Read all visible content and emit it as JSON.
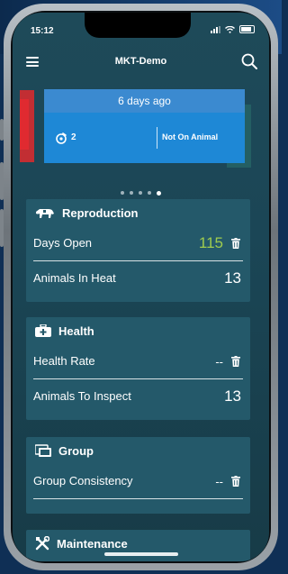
{
  "status": {
    "time": "15:12"
  },
  "header": {
    "title": "MKT-Demo"
  },
  "banner": {
    "heading": "6 days ago",
    "count": "2",
    "status": "Not On Animal"
  },
  "carousel": {
    "dots": 5,
    "active": 4
  },
  "sections": {
    "reproduction": {
      "title": "Reproduction",
      "rows": [
        {
          "label": "Days Open",
          "value": "115"
        },
        {
          "label": "Animals In Heat",
          "value": "13"
        }
      ]
    },
    "health": {
      "title": "Health",
      "rows": [
        {
          "label": "Health Rate",
          "value": "--"
        },
        {
          "label": "Animals To Inspect",
          "value": "13"
        }
      ]
    },
    "group": {
      "title": "Group",
      "rows": [
        {
          "label": "Group Consistency",
          "value": "--"
        }
      ]
    },
    "maintenance": {
      "title": "Maintenance"
    }
  },
  "colors": {
    "accent_green": "#9fcc4e",
    "banner_blue": "#1e88d6",
    "alert_red": "#c22e33"
  }
}
